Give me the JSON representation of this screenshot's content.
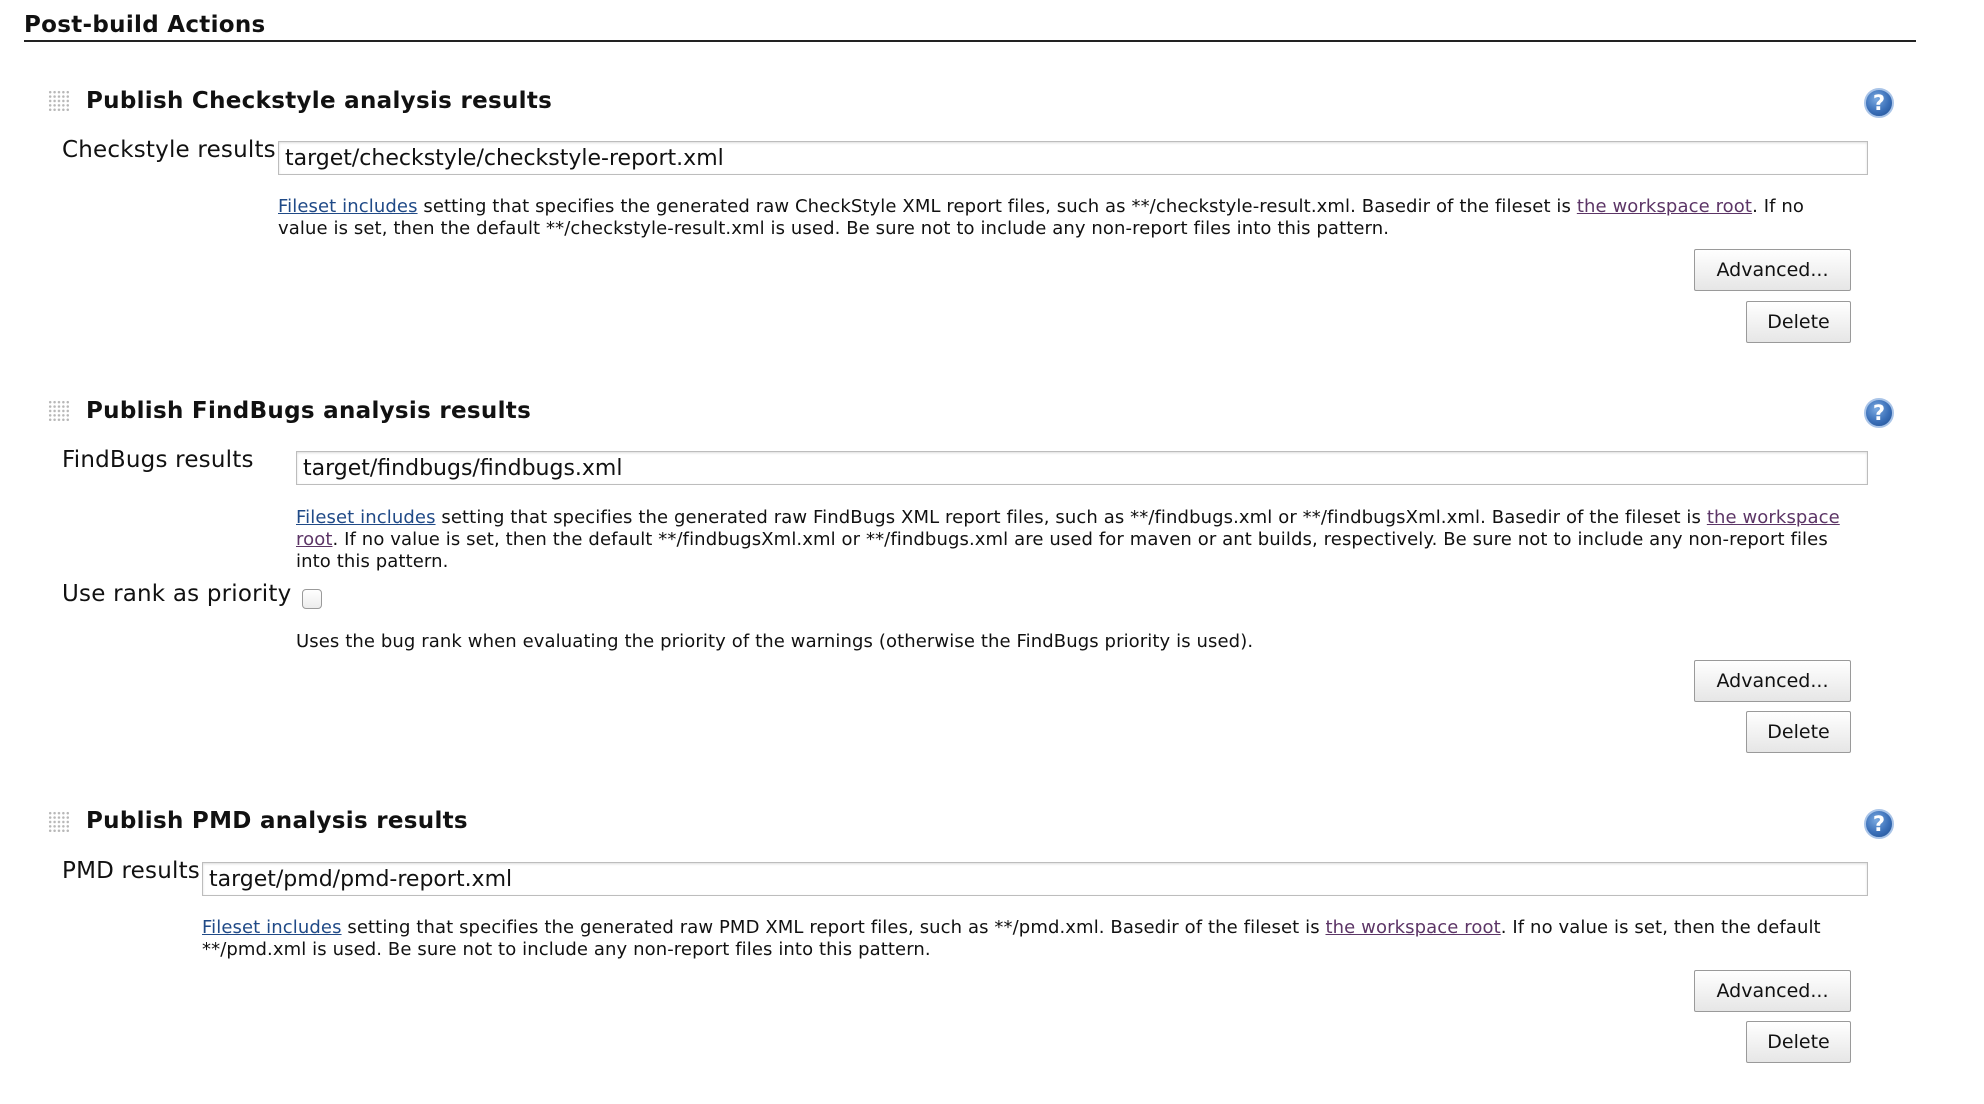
{
  "section": {
    "title": "Post-build Actions"
  },
  "checkstyle": {
    "title": "Publish Checkstyle analysis results",
    "field_label": "Checkstyle results",
    "field_value": "target/checkstyle/checkstyle-report.xml",
    "help_link1": "Fileset includes",
    "help_text1": " setting that specifies the generated raw CheckStyle XML report files, such as **/checkstyle-result.xml. Basedir of the fileset is ",
    "help_link2": "the workspace root",
    "help_text2": ". If no value is set, then the default **/checkstyle-result.xml is used. Be sure not to include any non-report files into this pattern.",
    "advanced_label": "Advanced...",
    "delete_label": "Delete"
  },
  "findbugs": {
    "title": "Publish FindBugs analysis results",
    "field_label": "FindBugs results",
    "field_value": "target/findbugs/findbugs.xml",
    "help_link1": "Fileset includes",
    "help_text1": " setting that specifies the generated raw FindBugs XML report files, such as **/findbugs.xml or **/findbugsXml.xml. Basedir of the fileset is ",
    "help_link2": "the workspace root",
    "help_text2": ". If no value is set, then the default **/findbugsXml.xml or **/findbugs.xml are used for maven or ant builds, respectively. Be sure not to include any non-report files into this pattern.",
    "rank_label": "Use rank as priority",
    "rank_checked": false,
    "rank_help": "Uses the bug rank when evaluating the priority of the warnings (otherwise the FindBugs priority is used).",
    "advanced_label": "Advanced...",
    "delete_label": "Delete"
  },
  "pmd": {
    "title": "Publish PMD analysis results",
    "field_label": "PMD results",
    "field_value": "target/pmd/pmd-report.xml",
    "help_link1": "Fileset includes",
    "help_text1": " setting that specifies the generated raw PMD XML report files, such as **/pmd.xml. Basedir of the fileset is ",
    "help_link2": "the workspace root",
    "help_text2": ". If no value is set, then the default **/pmd.xml is used. Be sure not to include any non-report files into this pattern.",
    "advanced_label": "Advanced...",
    "delete_label": "Delete"
  },
  "icons": {
    "help": "help-icon",
    "drag": "drag-handle-icon"
  },
  "colors": {
    "link": "#204a87",
    "visited_link": "#5c3566",
    "help_icon": "#3a6fb8"
  }
}
